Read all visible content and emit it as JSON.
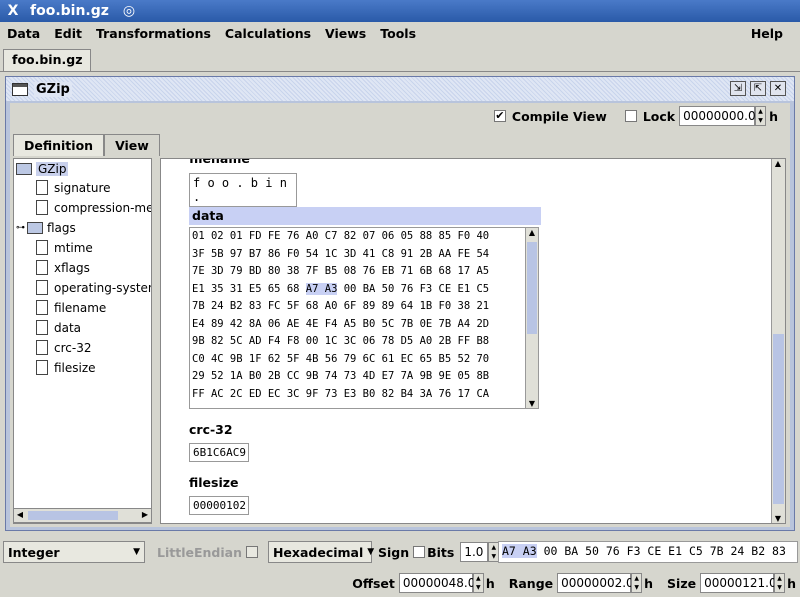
{
  "window": {
    "title": "foo.bin.gz"
  },
  "menu": [
    "Data",
    "Edit",
    "Transformations",
    "Calculations",
    "Views",
    "Tools"
  ],
  "menu_help": "Help",
  "doc_tab": "foo.bin.gz",
  "frame": {
    "title": "GZip"
  },
  "options": {
    "compile_view_label": "Compile View",
    "compile_view_checked": true,
    "lock_label": "Lock",
    "lock_checked": false,
    "lock_value": "00000000.0",
    "lock_unit": "h"
  },
  "view_tabs": [
    "Definition",
    "View"
  ],
  "tree": {
    "root": "GZip",
    "items": [
      "signature",
      "compression-me",
      "flags",
      "mtime",
      "xflags",
      "operating-systen",
      "filename",
      "data",
      "crc-32",
      "filesize"
    ]
  },
  "main": {
    "filename_label": "filename",
    "filename_value": "f o o . b i n .",
    "data_label": "data",
    "hex_rows": [
      "01 02 01 FD FE 76 A0 C7 82 07 06 05 88 85 F0 40",
      "3F 5B 97 B7 86 F0 54 1C 3D 41 C8 91 2B AA FE 54",
      "7E 3D 79 BD 80 38 7F B5 08 76 EB 71 6B 68 17 A5",
      "E1 35 31 E5 65 68 A7 A3 00 BA 50 76 F3 CE E1 C5",
      "7B 24 B2 83 FC 5F 68 A0 6F 89 89 64 1B F0 38 21",
      "E4 89 42 8A 06 AE 4E F4 A5 B0 5C 7B 0E 7B A4 2D",
      "9B 82 5C AD F4 F8 00 1C 3C 06 78 D5 A0 2B FF B8",
      "C0 4C 9B 1F 62 5F 4B 56 79 6C 61 EC 65 B5 52 70",
      "29 52 1A B0 2B CC 9B 74 73 4D E7 7A 9B 9E 05 8B",
      "FF AC 2C ED EC 3C 9F 73 E3 B0 82 B4 3A 76 17 CA"
    ],
    "highlight": "A7 A3",
    "crc_label": "crc-32",
    "crc_value": "6B1C6AC9",
    "filesize_label": "filesize",
    "filesize_value": "00000102"
  },
  "bottom": {
    "type_select": "Integer",
    "endian_label": "LittleEndian",
    "base_select": "Hexadecimal",
    "sign_label": "Sign",
    "bits_label": "Bits",
    "bits_value": "1.0",
    "bits_unit": "h",
    "hex_highlight": "A7 A3",
    "hex_rest": "00 BA 50 76 F3 CE E1 C5 7B 24 B2 83",
    "offset_label": "Offset",
    "offset_value": "00000048.0",
    "range_label": "Range",
    "range_value": "00000002.0",
    "size_label": "Size",
    "size_value": "00000121.0",
    "unit": "h"
  }
}
